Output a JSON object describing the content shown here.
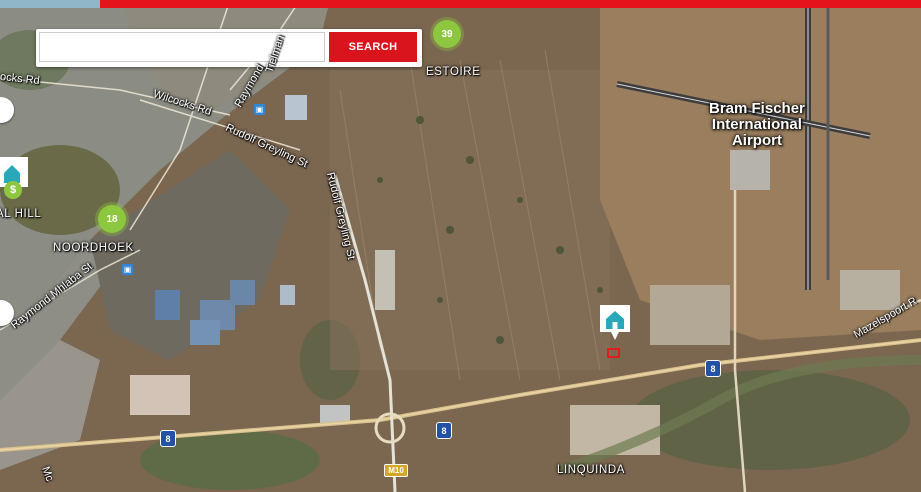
{
  "search": {
    "placeholder": "",
    "value": "",
    "button_label": "SEARCH"
  },
  "clusters": [
    {
      "id": "cluster-39",
      "count": "39"
    },
    {
      "id": "cluster-18",
      "count": "18"
    }
  ],
  "area_labels": {
    "estoire": "ESTOIRE",
    "noordhoek": "NOORDHOEK",
    "linquinda": "LINQUINDA",
    "hill": "AL HILL"
  },
  "street_labels": {
    "ocks_rd": "ocks Rd",
    "wilcocks_rd": "Wilcocks Rd",
    "raymond": "Raymond",
    "tielman": "Tielman",
    "rudolf_greyling_1": "Rudolf Greyling St",
    "rudolf_greyling_2": "Rudolf Greyling St",
    "raymond_mhlaba": "Raymond Mhlaba St",
    "mazelspoort": "Mazelspoort R",
    "mc": "Mc"
  },
  "airport": {
    "line1": "Bram Fischer",
    "line2": "International",
    "line3": "Airport"
  },
  "road_shields": {
    "n8_a": "8",
    "n8_b": "8",
    "n8_c": "8",
    "m10": "M10"
  },
  "colors": {
    "accent": "#e3141b",
    "cluster": "#8dc63f",
    "pin": "#2aa7b8",
    "selection": "#e31b1b"
  },
  "icons": {
    "house": "house-icon",
    "money": "dollar-icon",
    "bus": "bus-icon"
  }
}
